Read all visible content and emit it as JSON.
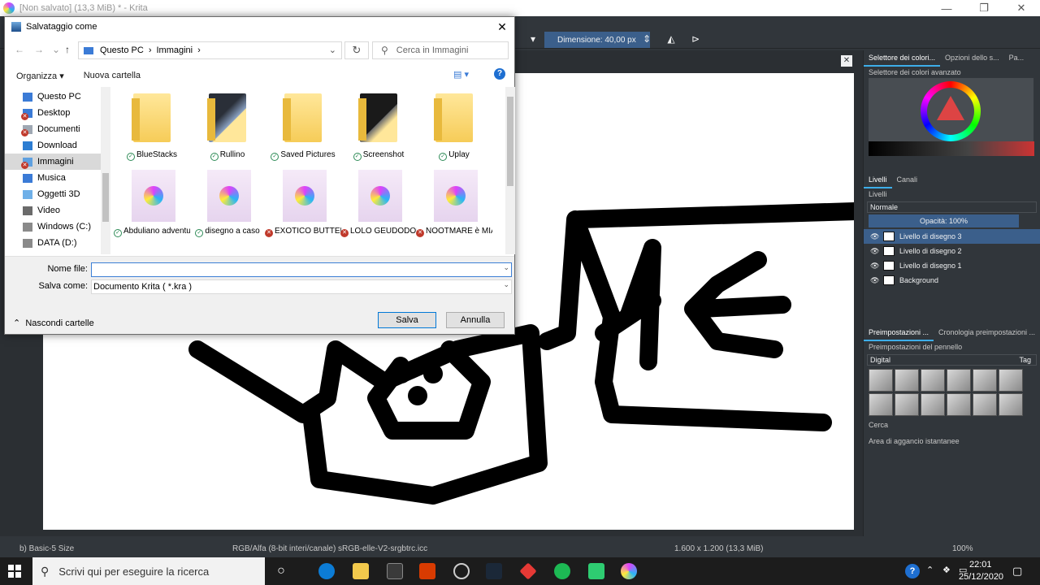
{
  "krita": {
    "title": "[Non salvato]  (13,3 MiB)  * - Krita",
    "window_controls": [
      "—",
      "❐",
      "✕"
    ],
    "toolbar": {
      "size_label": "Dimensione: 40,00 px"
    },
    "right_panel": {
      "top_tabs": [
        "Selettore dei colori...",
        "Opzioni dello s...",
        "Pa..."
      ],
      "color_selector_label": "Selettore dei colori avanzato",
      "layer_tabs": [
        "Livelli",
        "Canali"
      ],
      "layers_label": "Livelli",
      "blend_mode": "Normale",
      "opacity": "Opacità:  100%",
      "layers": [
        {
          "name": "Livello di disegno 3",
          "selected": true
        },
        {
          "name": "Livello di disegno 2",
          "selected": false
        },
        {
          "name": "Livello di disegno 1",
          "selected": false
        },
        {
          "name": "Background",
          "selected": false
        }
      ],
      "preset_tabs": [
        "Preimpostazioni ...",
        "Cronologia preimpostazioni ..."
      ],
      "preset_label": "Preimpostazioni del pennello",
      "preset_filter": "Digital",
      "tag_label": "Tag",
      "search_placeholder": "Cerca",
      "snap_label": "Area di aggancio istantanee"
    },
    "statusbar": {
      "brush": "b) Basic-5 Size",
      "colorspace": "RGB/Alfa (8-bit interi/canale)  sRGB-elle-V2-srgbtrc.icc",
      "dimensions": "1.600 x 1.200 (13,3 MiB)",
      "zoom": "100%"
    }
  },
  "dialog": {
    "title": "Salvataggio come",
    "breadcrumb": [
      "Questo PC",
      "Immagini"
    ],
    "search_placeholder": "Cerca in Immagini",
    "organize": "Organizza",
    "new_folder": "Nuova cartella",
    "nav_items": [
      {
        "label": "Questo PC",
        "icon": "pc-icon"
      },
      {
        "label": "Desktop",
        "icon": "desktop-icon",
        "error": true
      },
      {
        "label": "Documenti",
        "icon": "documents-icon",
        "error": true
      },
      {
        "label": "Download",
        "icon": "download-icon"
      },
      {
        "label": "Immagini",
        "icon": "pictures-icon",
        "error": true,
        "selected": true
      },
      {
        "label": "Musica",
        "icon": "music-icon"
      },
      {
        "label": "Oggetti 3D",
        "icon": "objects3d-icon"
      },
      {
        "label": "Video",
        "icon": "video-icon"
      },
      {
        "label": "Windows (C:)",
        "icon": "drive-icon"
      },
      {
        "label": "DATA (D:)",
        "icon": "drive-icon"
      }
    ],
    "files": [
      {
        "label": "BlueStacks",
        "kind": "folder",
        "status": "ok"
      },
      {
        "label": "Rullino",
        "kind": "folder-photo",
        "status": "ok"
      },
      {
        "label": "Saved Pictures",
        "kind": "folder",
        "status": "ok"
      },
      {
        "label": "Screenshot",
        "kind": "folder-dark",
        "status": "ok"
      },
      {
        "label": "Uplay",
        "kind": "folder",
        "status": "ok"
      },
      {
        "label": "Abduliano adventure test",
        "kind": "kra",
        "status": "ok"
      },
      {
        "label": "disegno a caso",
        "kind": "kra",
        "status": "ok"
      },
      {
        "label": "EXOTICO BUTTERO",
        "kind": "kra",
        "status": "error"
      },
      {
        "label": "LOLO GEUDODONE",
        "kind": "kra",
        "status": "error"
      },
      {
        "label": "NOOTMARE è MIA CUGINA",
        "kind": "kra",
        "status": "error"
      }
    ],
    "filename_label": "Nome file:",
    "filename_value": "",
    "savetype_label": "Salva come:",
    "savetype_value": "Documento Krita ( *.kra )",
    "hide_folders": "Nascondi cartelle",
    "save_button": "Salva",
    "cancel_button": "Annulla"
  },
  "taskbar": {
    "search_placeholder": "Scrivi qui per eseguire la ricerca",
    "time": "22:01",
    "date": "25/12/2020"
  }
}
